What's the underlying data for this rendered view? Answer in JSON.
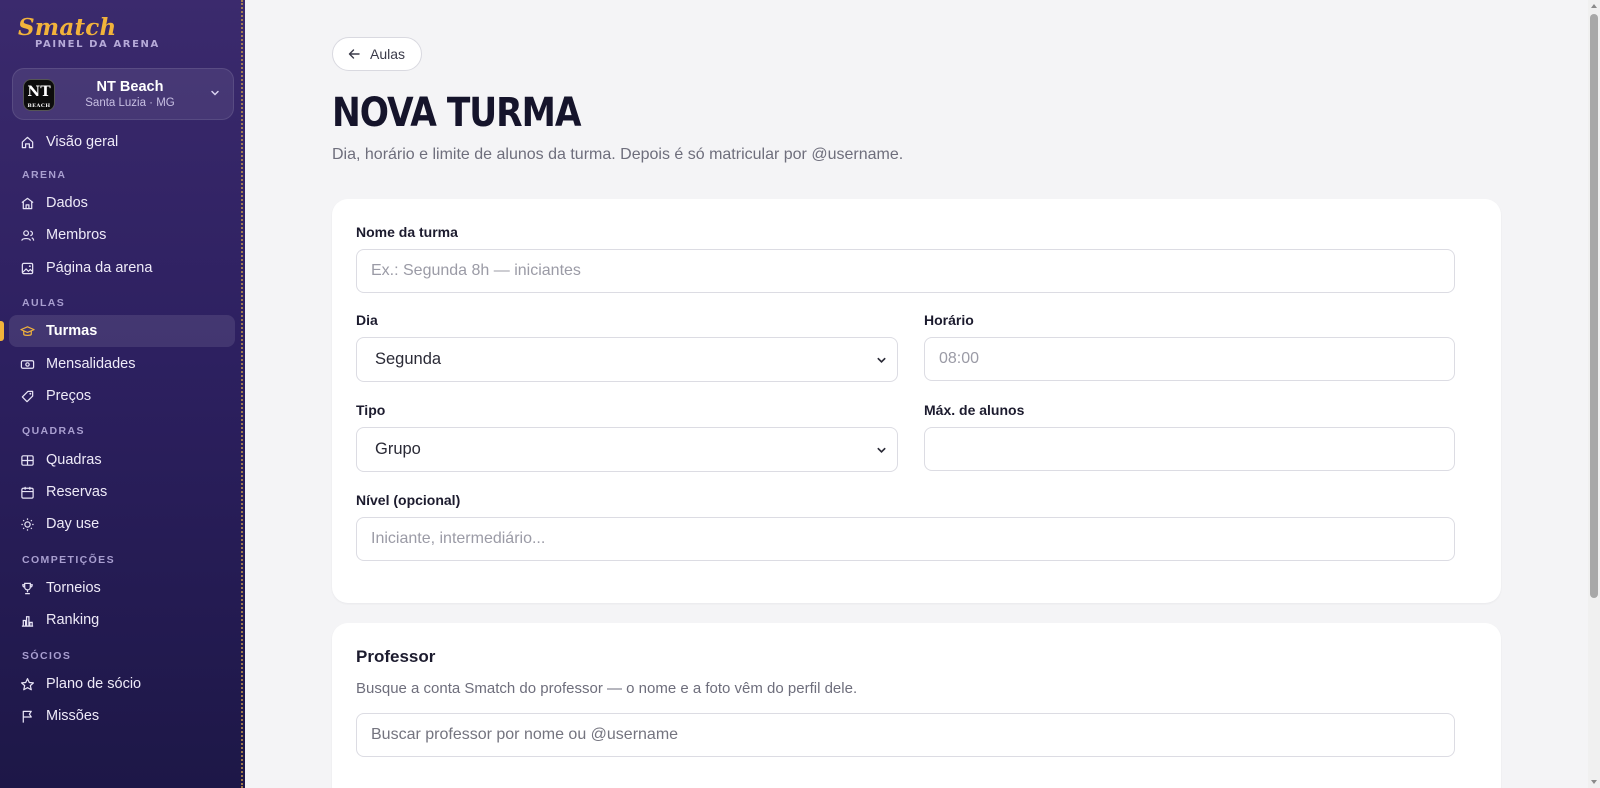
{
  "brand": {
    "logo": "Smatch",
    "subtitle": "PAINEL DA ARENA"
  },
  "arena": {
    "avatar_text": "NT",
    "avatar_small": "BEACH",
    "name": "NT Beach",
    "location": "Santa Luzia · MG"
  },
  "sidebar": {
    "overview": "Visão geral",
    "sections": {
      "arena": "ARENA",
      "aulas": "AULAS",
      "quadras": "QUADRAS",
      "competicoes": "COMPETIÇÕES",
      "socios": "SÓCIOS"
    },
    "items": {
      "dados": "Dados",
      "membros": "Membros",
      "pagina": "Página da arena",
      "turmas": "Turmas",
      "mensalidades": "Mensalidades",
      "precos": "Preços",
      "quadras": "Quadras",
      "reservas": "Reservas",
      "dayuse": "Day use",
      "torneios": "Torneios",
      "ranking": "Ranking",
      "plano": "Plano de sócio",
      "missoes": "Missões"
    },
    "active": "Turmas",
    "accent_color": "#f2b33b"
  },
  "main": {
    "back_label": "Aulas",
    "title": "NOVA TURMA",
    "subtitle": "Dia, horário e limite de alunos da turma. Depois é só matricular por @username."
  },
  "form": {
    "nome_label": "Nome da turma",
    "nome_placeholder": "Ex.: Segunda 8h — iniciantes",
    "dia_label": "Dia",
    "dia_value": "Segunda",
    "horario_label": "Horário",
    "horario_placeholder": "08:00",
    "tipo_label": "Tipo",
    "tipo_value": "Grupo",
    "max_label": "Máx. de alunos",
    "max_value": "",
    "nivel_label": "Nível (opcional)",
    "nivel_placeholder": "Iniciante, intermediário..."
  },
  "professor": {
    "title": "Professor",
    "description": "Busque a conta Smatch do professor — o nome e a foto vêm do perfil dele.",
    "search_placeholder": "Buscar professor por nome ou @username"
  }
}
